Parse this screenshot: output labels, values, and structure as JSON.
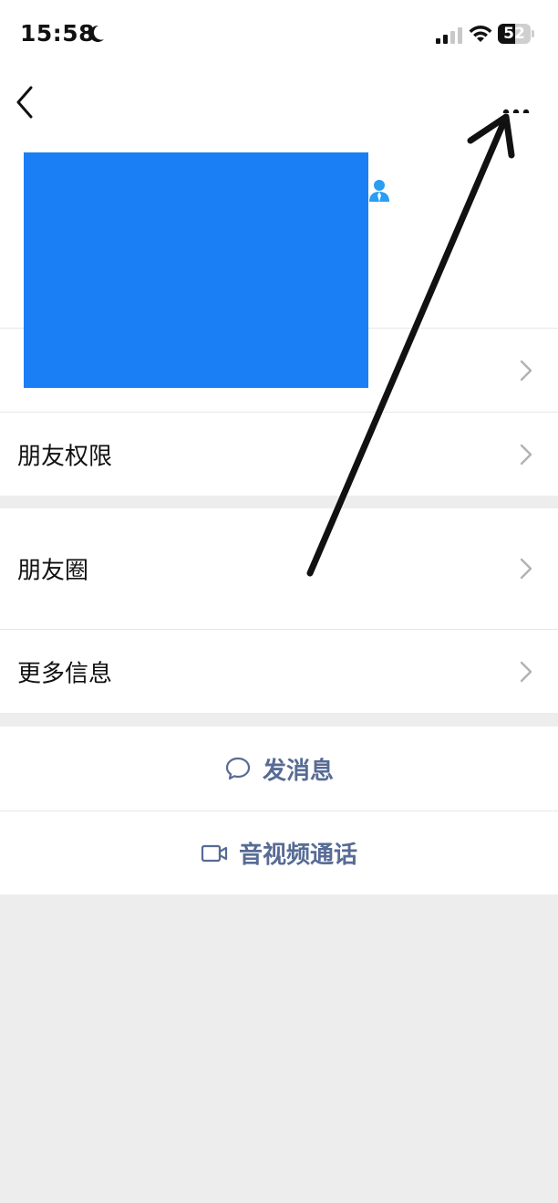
{
  "status_bar": {
    "time": "15:58",
    "battery": "52",
    "battery_fraction": 0.52,
    "icons": [
      "moon-icon",
      "signal-icon",
      "wifi-icon",
      "battery-icon"
    ]
  },
  "nav": {
    "icons": [
      "back-icon",
      "more-icon"
    ]
  },
  "profile": {
    "icon": "person-icon",
    "accent": "#1aad19"
  },
  "rows": {
    "row1": {
      "label": ""
    },
    "row2": {
      "label": "朋友权限"
    },
    "row3": {
      "label": "朋友圈"
    },
    "row4": {
      "label": "更多信息"
    }
  },
  "actions": {
    "message": "发消息",
    "call": "音视频通话",
    "color": "#576b95"
  },
  "overlay": {
    "redaction_color": "#1a7ff5",
    "arrow_color": "#111111"
  }
}
